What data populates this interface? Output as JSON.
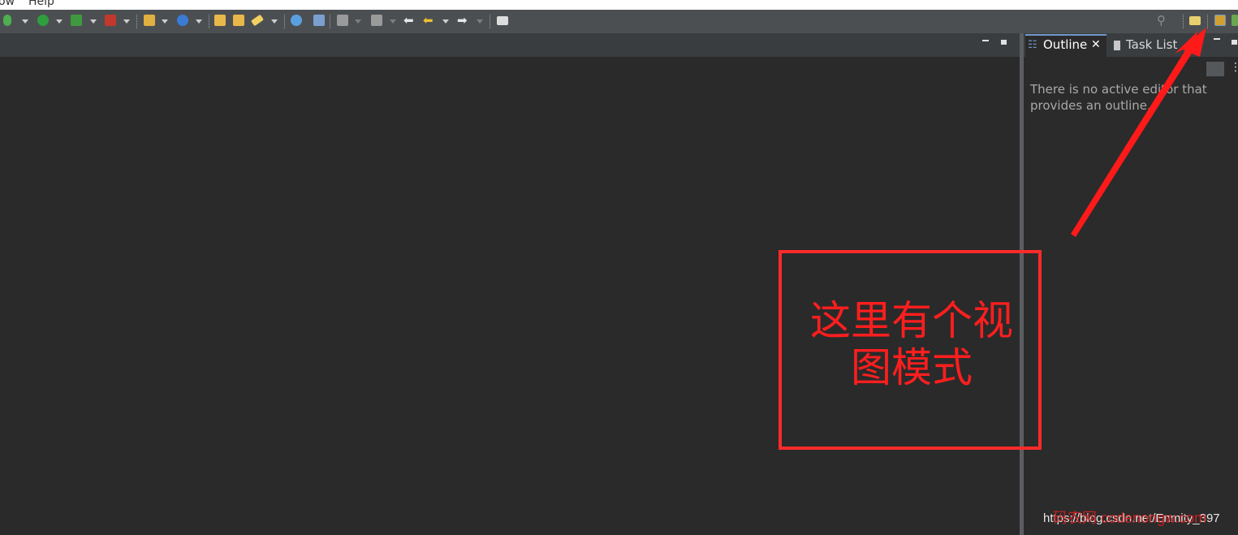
{
  "menu": {
    "items": [
      "ow",
      "Help"
    ]
  },
  "toolbar": {
    "buttons": [
      {
        "icon": "debug-icon",
        "color": "#4caf50"
      },
      {
        "icon": "run-icon",
        "color": "#2e9e3e"
      },
      {
        "icon": "run-last-tool-icon",
        "color": "#3f9a3f"
      },
      {
        "icon": "external-tools-icon",
        "color": "#c0392b"
      },
      {
        "icon": "new-java-project-icon",
        "color": "#e0b040"
      },
      {
        "icon": "new-class-icon",
        "color": "#3a7bd5"
      },
      {
        "icon": "open-type-icon",
        "color": "#e8b84a"
      },
      {
        "icon": "open-task-icon",
        "color": "#e8b84a"
      },
      {
        "icon": "marker-icon",
        "color": "#f0d060"
      },
      {
        "icon": "globe-icon",
        "color": "#5aa0e0"
      },
      {
        "icon": "search-icon",
        "color": "#7aa0d0"
      },
      {
        "icon": "next-annotation-icon",
        "color": "#dcdcdc"
      },
      {
        "icon": "previous-annotation-icon",
        "color": "#dcdcdc"
      },
      {
        "icon": "last-edit-location-icon",
        "color": "#ffffff"
      },
      {
        "icon": "back-icon",
        "color": "#f0c030"
      },
      {
        "icon": "forward-icon",
        "color": "#ffffff"
      },
      {
        "icon": "pin-editor-icon",
        "color": "#dcdcdc"
      }
    ],
    "right": {
      "quick-access-icon": "search-icon",
      "open-perspective-icon": "open-perspective-icon",
      "java-perspective-icon": "java-perspective-icon"
    }
  },
  "side_panel": {
    "tabs": [
      {
        "label": "Outline",
        "active": true,
        "icon": "outline-icon"
      },
      {
        "label": "Task List",
        "active": false,
        "icon": "task-list-icon"
      }
    ],
    "close_glyph": "✕",
    "message": "There is no active editor that provides an outline."
  },
  "annotation": {
    "text": "这里有个视图模式",
    "color": "#ff1e1e"
  },
  "watermark": {
    "url": "https://blog.csdn.net/Enmity_397",
    "overlay": "码农网 codenongw.com"
  }
}
